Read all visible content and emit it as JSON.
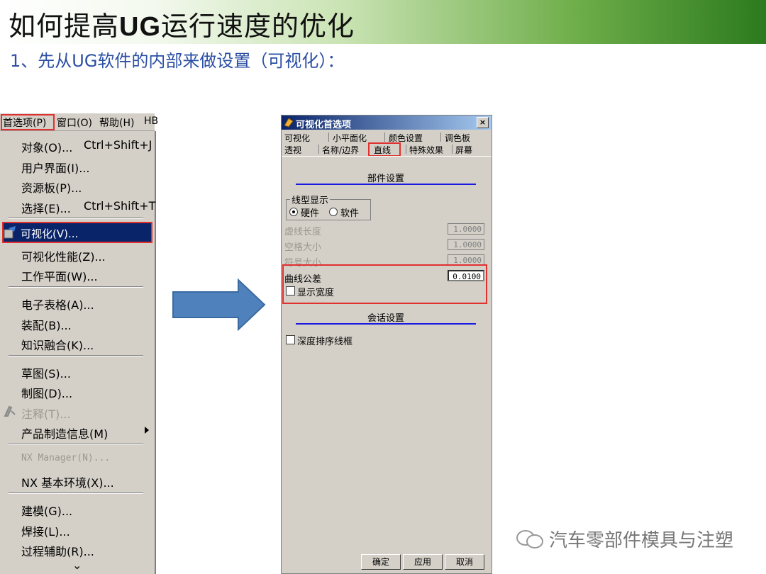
{
  "slide": {
    "title_prefix": "如何提高",
    "title_bold": "UG",
    "title_suffix": "运行速度的优化",
    "subtitle": "1、先从UG软件的内部来做设置（可视化）："
  },
  "menubar": {
    "items": [
      "首选项(P)",
      "窗口(O)",
      "帮助(H)",
      "HB"
    ]
  },
  "menu": {
    "items": [
      {
        "label": "对象(O)...",
        "shortcut": "Ctrl+Shift+J"
      },
      {
        "label": "用户界面(I)..."
      },
      {
        "label": "资源板(P)..."
      },
      {
        "label": "选择(E)...",
        "shortcut": "Ctrl+Shift+T"
      },
      {
        "label": "可视化(V)..."
      },
      {
        "label": "可视化性能(Z)..."
      },
      {
        "label": "工作平面(W)..."
      },
      {
        "label": "电子表格(A)..."
      },
      {
        "label": "装配(B)..."
      },
      {
        "label": "知识融合(K)..."
      },
      {
        "label": "草图(S)..."
      },
      {
        "label": "制图(D)..."
      },
      {
        "label": "注释(T)..."
      },
      {
        "label": "产品制造信息(M)"
      },
      {
        "label": "NX Manager(N)..."
      },
      {
        "label": "NX 基本环境(X)..."
      },
      {
        "label": "建模(G)..."
      },
      {
        "label": "焊接(L)..."
      },
      {
        "label": "过程辅助(R)..."
      }
    ],
    "more": "⌄"
  },
  "dialog": {
    "title": "可视化首选项",
    "close": "×",
    "tabs_row1": [
      "可视化",
      "小平面化",
      "颜色设置",
      "调色板"
    ],
    "tabs_row2": [
      "透视",
      "名称/边界",
      "直线",
      "特殊效果",
      "屏幕"
    ],
    "section_part": "部件设置",
    "linetype_group": "线型显示",
    "radio_hardware": "硬件",
    "radio_software": "软件",
    "fields": [
      {
        "label": "虚线长度",
        "value": "1.0000"
      },
      {
        "label": "空格大小",
        "value": "1.0000"
      },
      {
        "label": "符号大小",
        "value": "1.0000"
      },
      {
        "label": "曲线公差",
        "value": "0.0100"
      }
    ],
    "show_width": "显示宽度",
    "section_session": "会话设置",
    "depth_sort": "深度排序线框",
    "buttons": {
      "ok": "确定",
      "apply": "应用",
      "cancel": "取消"
    }
  },
  "watermark": "汽车零部件模具与注塑",
  "colors": {
    "title_green": "#2c7a1e",
    "subtitle_blue": "#2b4fa3",
    "arrow_blue": "#4f81bd",
    "highlight_red": "#e03030"
  }
}
